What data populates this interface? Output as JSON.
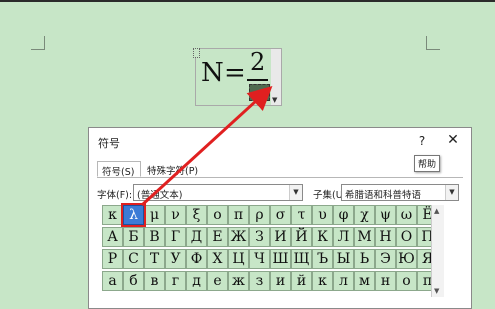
{
  "equation": {
    "lhs": "N",
    "equals": "=",
    "numerator": "2"
  },
  "dialog": {
    "title": "符号",
    "help_label": "?",
    "close_label": "✕",
    "tooltip": "帮助",
    "tabs": [
      "符号(S)",
      "特殊字符(P)"
    ],
    "font_label": "字体(F):",
    "font_value": "(普通文本)",
    "subset_label": "子集(U):",
    "subset_value": "希腊语和科普特语",
    "selected_symbol": "λ"
  },
  "symbols": {
    "rows": [
      [
        "κ",
        "λ",
        "μ",
        "ν",
        "ξ",
        "ο",
        "π",
        "ρ",
        "σ",
        "τ",
        "υ",
        "φ",
        "χ",
        "ψ",
        "ω",
        "Ё"
      ],
      [
        "А",
        "Б",
        "В",
        "Г",
        "Д",
        "Е",
        "Ж",
        "З",
        "И",
        "Й",
        "К",
        "Л",
        "М",
        "Н",
        "О",
        "П"
      ],
      [
        "Р",
        "С",
        "Т",
        "У",
        "Ф",
        "Х",
        "Ц",
        "Ч",
        "Ш",
        "Щ",
        "Ъ",
        "Ы",
        "Ь",
        "Э",
        "Ю",
        "Я"
      ],
      [
        "а",
        "б",
        "в",
        "г",
        "д",
        "е",
        "ж",
        "з",
        "и",
        "й",
        "к",
        "л",
        "м",
        "н",
        "о",
        "п"
      ]
    ]
  },
  "colors": {
    "page_background": "#c7e6c7",
    "annotation_red": "#e02020",
    "selection_blue": "#3b7bd6"
  }
}
